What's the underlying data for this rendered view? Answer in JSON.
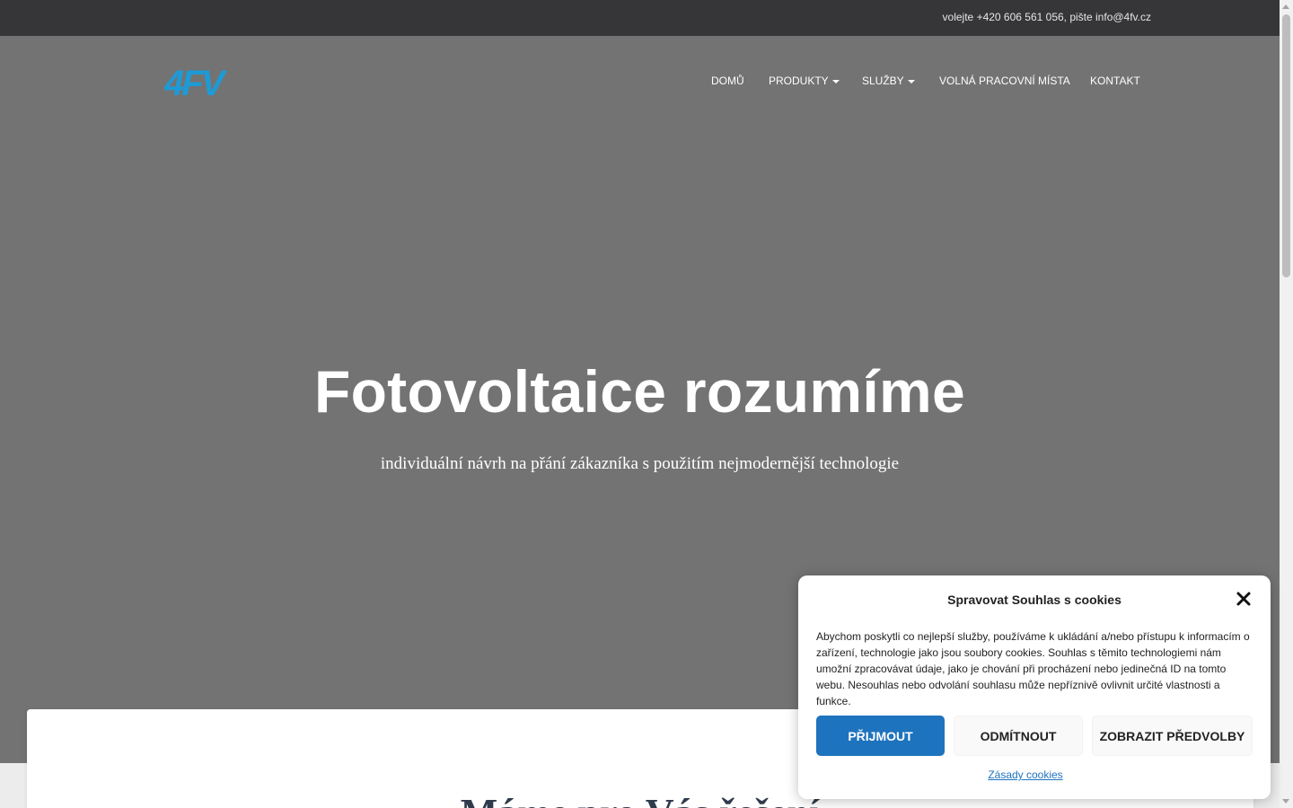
{
  "topbar": {
    "contact": "volejte +420 606 561 056, pište info@4fv.cz"
  },
  "brand": {
    "logo_text": "4FV",
    "logo_color": "#1e9ad6"
  },
  "nav": {
    "items": [
      {
        "label": "DOMŮ",
        "dropdown": false
      },
      {
        "label": "PRODUKTY",
        "dropdown": true
      },
      {
        "label": "SLUŽBY",
        "dropdown": true
      },
      {
        "label": "VOLNÁ PRACOVNÍ MÍSTA",
        "dropdown": false
      },
      {
        "label": "KONTAKT",
        "dropdown": false
      }
    ]
  },
  "hero": {
    "title": "Fotovoltaice rozumíme",
    "subtitle": "individuální návrh na přání zákazníka s použitím nejmodernější technologie",
    "overlay_color": "#737373"
  },
  "section": {
    "heading": "Máme pro Vás řešení"
  },
  "cookie": {
    "title": "Spravovat Souhlas s cookies",
    "text": "Abychom poskytli co nejlepší služby, používáme k ukládání a/nebo přístupu k informacím o zařízení, technologie jako jsou soubory cookies. Souhlas s těmito technologiemi nám umožní zpracovávat údaje, jako je chování při procházení nebo jedinečná ID na tomto webu. Nesouhlas nebo odvolání souhlasu může nepříznivě ovlivnit určité vlastnosti a funkce.",
    "accept": "PŘIJMOUT",
    "deny": "ODMÍTNOUT",
    "preferences": "ZOBRAZIT PŘEDVOLBY",
    "policy_link": "Zásady cookies",
    "accent_color": "#1e73be"
  }
}
